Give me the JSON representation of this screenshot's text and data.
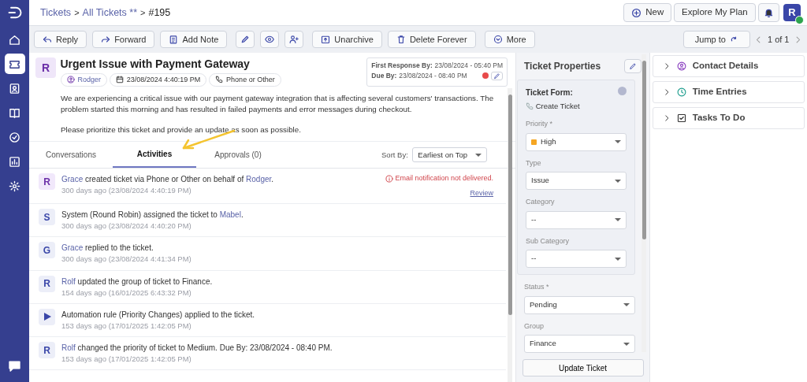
{
  "sidebar": {
    "items": [
      {
        "selected": false
      },
      {
        "selected": true
      },
      {
        "selected": false
      },
      {
        "selected": false
      },
      {
        "selected": false
      },
      {
        "selected": false
      },
      {
        "selected": false
      }
    ]
  },
  "breadcrumb": [
    {
      "kind": "link",
      "text": "Tickets"
    },
    {
      "kind": "separator",
      "text": ">"
    },
    {
      "kind": "link",
      "text": "All Tickets **"
    },
    {
      "kind": "separator",
      "text": ">"
    },
    {
      "kind": "current",
      "text": "#195"
    }
  ],
  "header_buttons": {
    "new": "New",
    "plan": "Explore My Plan",
    "avatar": "R",
    "online": true
  },
  "toolbar": {
    "buttons": [
      {
        "kind": "text",
        "label": "Reply"
      },
      {
        "kind": "text",
        "label": "Forward"
      },
      {
        "kind": "text",
        "label": "Add Note"
      },
      {
        "kind": "icon"
      },
      {
        "kind": "icon"
      },
      {
        "kind": "icon"
      },
      {
        "kind": "text",
        "label": "Unarchive"
      },
      {
        "kind": "text",
        "label": "Delete Forever"
      },
      {
        "kind": "text",
        "label": "More"
      }
    ],
    "jump": "Jump to",
    "pager": "1 of 1"
  },
  "ticket": {
    "avatar": "R",
    "title": "Urgent Issue with Payment Gateway",
    "requester": "Rodger",
    "created": "23/08/2024 4:40:19 PM",
    "source": "Phone or Other",
    "sla": [
      {
        "label": "First Response By:",
        "value": "23/08/2024 - 05:40 PM",
        "overdue": false
      },
      {
        "label": "Due By:",
        "value": "23/08/2024 - 08:40 PM",
        "overdue": true
      }
    ],
    "description": [
      "We are experiencing a critical issue with our payment gateway integration that is affecting several customers' transactions. The problem started this morning and has resulted in failed payments and error messages during checkout.",
      "Please prioritize this ticket and provide an update as soon as possible."
    ]
  },
  "tabs": [
    {
      "label": "Conversations",
      "selected": false
    },
    {
      "label": "Activities",
      "selected": true
    },
    {
      "label": "Approvals (0)",
      "selected": false
    }
  ],
  "sort": {
    "label": "Sort By:",
    "value": "Earliest on Top"
  },
  "activities": [
    {
      "kind": "user",
      "avatar": "R",
      "parts": [
        {
          "kind": "link",
          "text": "Grace"
        },
        {
          "kind": "text",
          "text": " created ticket via Phone or Other on behalf of "
        },
        {
          "kind": "link",
          "text": "Rodger"
        },
        {
          "kind": "text",
          "text": "."
        }
      ],
      "time": "300 days ago (23/08/2024 4:40:19 PM)",
      "notice": "Email notification not delivered.",
      "action": "Review"
    },
    {
      "kind": "user",
      "avatar": "S",
      "parts": [
        {
          "kind": "text",
          "text": "System (Round Robin) assigned the ticket to "
        },
        {
          "kind": "link",
          "text": "Mabel"
        },
        {
          "kind": "text",
          "text": "."
        }
      ],
      "time": "300 days ago (23/08/2024 4:40:20 PM)"
    },
    {
      "kind": "user",
      "avatar": "G",
      "parts": [
        {
          "kind": "link",
          "text": "Grace"
        },
        {
          "kind": "text",
          "text": " replied to the ticket."
        }
      ],
      "time": "300 days ago (23/08/2024 4:41:34 PM)"
    },
    {
      "kind": "user",
      "avatar": "R",
      "parts": [
        {
          "kind": "link",
          "text": "Rolf"
        },
        {
          "kind": "text",
          "text": " updated the group of ticket to Finance."
        }
      ],
      "time": "154 days ago (16/01/2025 6:43:32 PM)"
    },
    {
      "kind": "automation",
      "parts": [
        {
          "kind": "text",
          "text": "Automation rule (Priority Changes) applied to the ticket."
        }
      ],
      "time": "153 days ago (17/01/2025 1:42:05 PM)"
    },
    {
      "kind": "user",
      "avatar": "R",
      "parts": [
        {
          "kind": "link",
          "text": "Rolf"
        },
        {
          "kind": "text",
          "text": " changed the priority of ticket to Medium. Due By: 23/08/2024 - 08:40 PM."
        }
      ],
      "time": "153 days ago (17/01/2025 1:42:05 PM)"
    }
  ],
  "properties": {
    "title": "Ticket Properties",
    "form_label": "Ticket Form:",
    "form_name": "Create Ticket",
    "form_fields": [
      {
        "label": "Priority",
        "required_mark": "*",
        "value": "High",
        "color": "#f5a623"
      },
      {
        "label": "Type",
        "value": "Issue"
      },
      {
        "label": "Category",
        "value": "--"
      },
      {
        "label": "Sub Category",
        "value": "--"
      }
    ],
    "fields": [
      {
        "label": "Status",
        "required_mark": "*",
        "value": "Pending"
      },
      {
        "label": "Group",
        "value": "Finance"
      }
    ],
    "button": "Update Ticket"
  },
  "panels": [
    {
      "title": "Contact Details",
      "expanded": false
    },
    {
      "title": "Time Entries",
      "expanded": false
    },
    {
      "title": "Tasks To Do",
      "expanded": false
    }
  ]
}
